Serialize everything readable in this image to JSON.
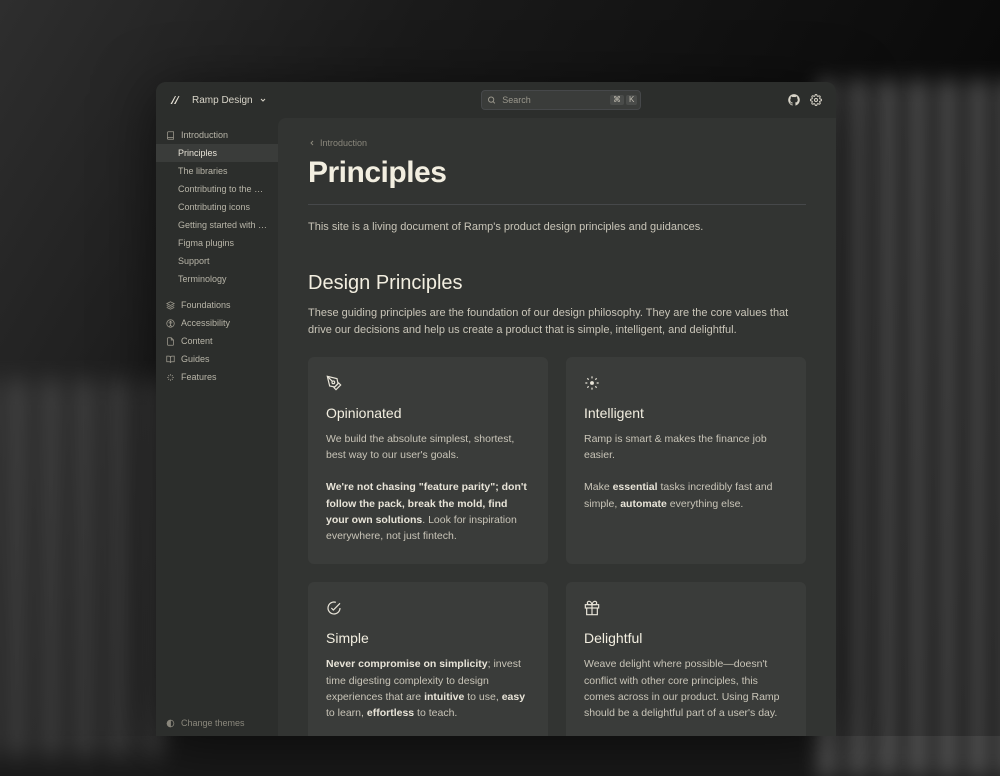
{
  "header": {
    "workspace": "Ramp Design",
    "search_placeholder": "Search",
    "kbd1": "⌘",
    "kbd2": "K"
  },
  "sidebar": {
    "groups": [
      {
        "icon": "book",
        "label": "Introduction",
        "children": [
          {
            "label": "Principles",
            "active": true
          },
          {
            "label": "The libraries"
          },
          {
            "label": "Contributing to the desig…"
          },
          {
            "label": "Contributing icons"
          },
          {
            "label": "Getting started with Figm…"
          },
          {
            "label": "Figma plugins"
          },
          {
            "label": "Support"
          },
          {
            "label": "Terminology"
          }
        ]
      },
      {
        "icon": "layers",
        "label": "Foundations"
      },
      {
        "icon": "accessibility",
        "label": "Accessibility"
      },
      {
        "icon": "document",
        "label": "Content"
      },
      {
        "icon": "book-open",
        "label": "Guides"
      },
      {
        "icon": "sparkle",
        "label": "Features"
      }
    ],
    "footer": "Change themes"
  },
  "breadcrumb": {
    "parent": "Introduction"
  },
  "page": {
    "title": "Principles",
    "intro": "This site is a living document of Ramp's product design principles and guidances.",
    "section_title": "Design Principles",
    "section_desc": "These guiding principles are the foundation of our design philosophy. They are the core values that drive our decisions and help us create a product that is simple, intelligent, and delightful."
  },
  "cards": [
    {
      "icon": "pen",
      "title": "Opinionated",
      "body_html": "We build the absolute simplest, shortest, best way to our user's goals.<br><br><strong>We're not chasing \"feature parity\"; don't follow the pack, break the mold, find your own solutions</strong>. Look for inspiration everywhere, not just fintech."
    },
    {
      "icon": "sparkle-burst",
      "title": "Intelligent",
      "body_html": "Ramp is smart & makes the finance job easier.<br><br>Make <strong>essential</strong> tasks incredibly fast and simple, <strong>automate</strong> everything else."
    },
    {
      "icon": "check-circle",
      "title": "Simple",
      "body_html": "<strong>Never compromise on simplicity</strong>; invest time digesting complexity to design experiences that are <strong>intuitive</strong> to use, <strong>easy</strong> to learn, <strong>effortless</strong> to teach."
    },
    {
      "icon": "gift",
      "title": "Delightful",
      "body_html": "Weave delight where possible—doesn't conflict with other core principles, this comes across in our product. Using Ramp should be a delightful part of a user's day."
    }
  ]
}
